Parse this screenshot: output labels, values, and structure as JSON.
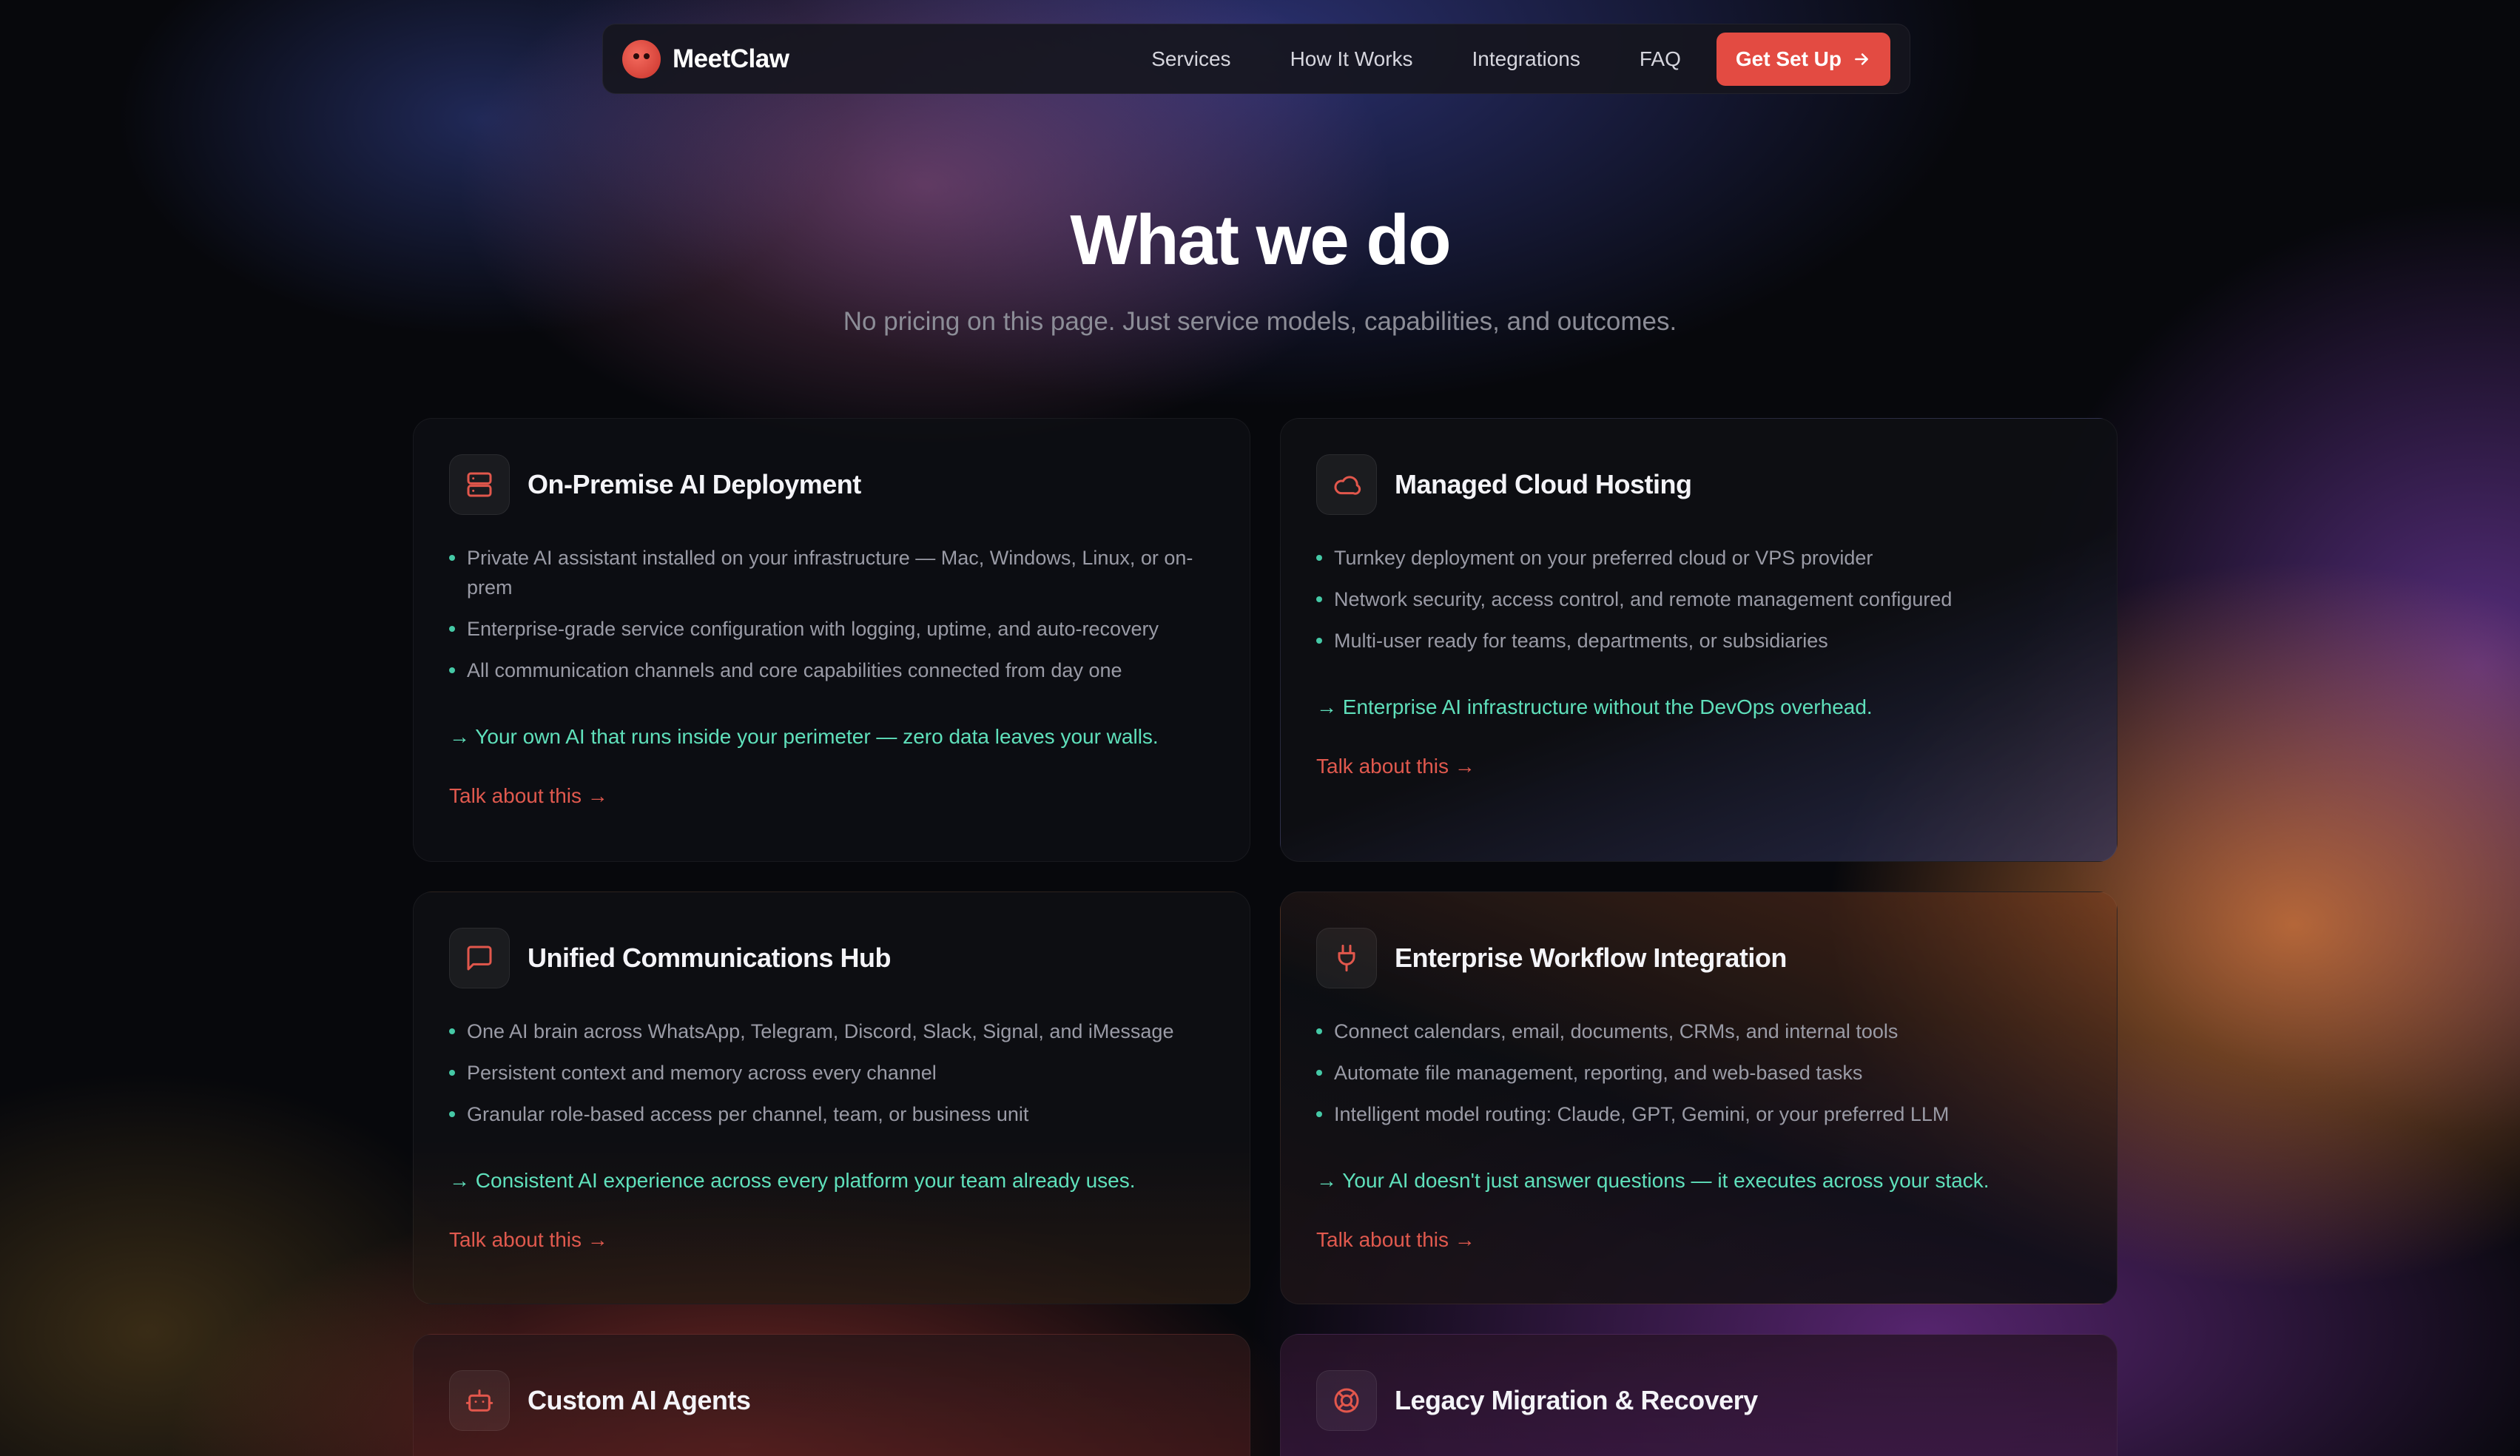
{
  "brand": {
    "name": "MeetClaw",
    "accent": "#e34b42",
    "teal": "#5fe0bb"
  },
  "nav": {
    "links": [
      "Services",
      "How It Works",
      "Integrations",
      "FAQ"
    ],
    "cta": "Get Set Up"
  },
  "hero": {
    "title": "What we do",
    "subtitle": "No pricing on this page. Just service models, capabilities, and outcomes."
  },
  "cards": [
    {
      "icon": "server-icon",
      "title": "On-Premise AI Deployment",
      "bullets": [
        "Private AI assistant installed on your infrastructure — Mac, Windows, Linux, or on-prem",
        "Enterprise-grade service configuration with logging, uptime, and auto-recovery",
        "All communication channels and core capabilities connected from day one"
      ],
      "outcome": "→ Your own AI that runs inside your perimeter — zero data leaves your walls.",
      "link": "Talk about this →"
    },
    {
      "icon": "cloud-icon",
      "title": "Managed Cloud Hosting",
      "bullets": [
        "Turnkey deployment on your preferred cloud or VPS provider",
        "Network security, access control, and remote management configured",
        "Multi-user ready for teams, departments, or subsidiaries"
      ],
      "outcome": "→ Enterprise AI infrastructure without the DevOps overhead.",
      "link": "Talk about this →"
    },
    {
      "icon": "chat-bubble-icon",
      "title": "Unified Communications Hub",
      "bullets": [
        "One AI brain across WhatsApp, Telegram, Discord, Slack, Signal, and iMessage",
        "Persistent context and memory across every channel",
        "Granular role-based access per channel, team, or business unit"
      ],
      "outcome": "→ Consistent AI experience across every platform your team already uses.",
      "link": "Talk about this →"
    },
    {
      "icon": "plug-icon",
      "title": "Enterprise Workflow Integration",
      "bullets": [
        "Connect calendars, email, documents, CRMs, and internal tools",
        "Automate file management, reporting, and web-based tasks",
        "Intelligent model routing: Claude, GPT, Gemini, or your preferred LLM"
      ],
      "outcome": "→ Your AI doesn't just answer questions — it executes across your stack.",
      "link": "Talk about this →"
    },
    {
      "icon": "robot-icon",
      "title": "Custom AI Agents"
    },
    {
      "icon": "lifebuoy-icon",
      "title": "Legacy Migration & Recovery"
    }
  ]
}
